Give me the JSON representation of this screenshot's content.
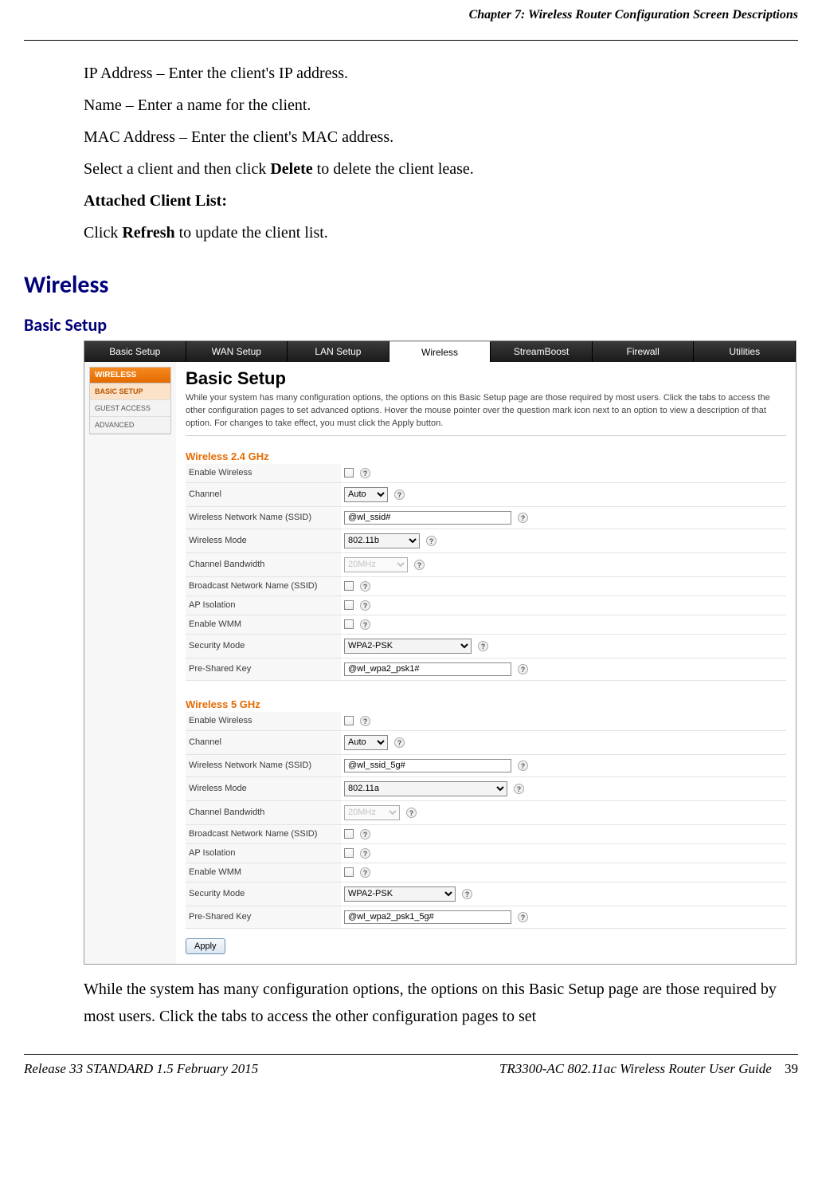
{
  "header": {
    "chapter": "Chapter 7: Wireless Router Configuration Screen Descriptions"
  },
  "intro": {
    "p1": "IP Address – Enter the client's IP address.",
    "p2": "Name – Enter a name for the client.",
    "p3": "MAC Address – Enter the client's MAC address.",
    "p4_pre": "Select a client and then click ",
    "p4_b": "Delete",
    "p4_post": " to delete the client lease.",
    "p5": "Attached Client List:",
    "p6_pre": "Click ",
    "p6_b": "Refresh",
    "p6_post": " to update the client list."
  },
  "h1": "Wireless",
  "h2": "Basic Setup",
  "router": {
    "tabs": [
      "Basic Setup",
      "WAN Setup",
      "LAN Setup",
      "Wireless",
      "StreamBoost",
      "Firewall",
      "Utilities"
    ],
    "sidebar": {
      "head": "WIRELESS",
      "items": [
        "BASIC SETUP",
        "GUEST ACCESS",
        "ADVANCED"
      ]
    },
    "title": "Basic Setup",
    "desc": "While your system has many configuration options, the options on this Basic Setup page are those required by most users. Click the tabs to access the other configuration pages to set advanced options. Hover the mouse pointer over the question mark icon next to an option to view a description of that option. For changes to take effect, you must click the Apply button.",
    "g24": {
      "title": "Wireless 2.4 GHz",
      "rows": {
        "enable": "Enable Wireless",
        "channel_lbl": "Channel",
        "channel_val": "Auto",
        "ssid_lbl": "Wireless Network Name (SSID)",
        "ssid_val": "@wl_ssid#",
        "mode_lbl": "Wireless Mode",
        "mode_val": "802.11b",
        "bw_lbl": "Channel Bandwidth",
        "bw_val": "20MHz",
        "broadcast": "Broadcast Network Name (SSID)",
        "ap": "AP Isolation",
        "wmm": "Enable WMM",
        "sec_lbl": "Security Mode",
        "sec_val": "WPA2-PSK",
        "psk_lbl": "Pre-Shared Key",
        "psk_val": "@wl_wpa2_psk1#"
      }
    },
    "g5": {
      "title": "Wireless 5 GHz",
      "rows": {
        "enable": "Enable Wireless",
        "channel_lbl": "Channel",
        "channel_val": "Auto",
        "ssid_lbl": "Wireless Network Name (SSID)",
        "ssid_val": "@wl_ssid_5g#",
        "mode_lbl": "Wireless Mode",
        "mode_val": "802.11a",
        "bw_lbl": "Channel Bandwidth",
        "bw_val": "20MHz",
        "broadcast": "Broadcast Network Name (SSID)",
        "ap": "AP Isolation",
        "wmm": "Enable WMM",
        "sec_lbl": "Security Mode",
        "sec_val": "WPA2-PSK",
        "psk_lbl": "Pre-Shared Key",
        "psk_val": "@wl_wpa2_psk1_5g#"
      }
    },
    "apply": "Apply"
  },
  "outro": "While the system has many configuration options, the options on this Basic Setup page are those required by most users.  Click the tabs to access the other configuration pages to set",
  "footer": {
    "left": "Release 33 STANDARD 1.5    February 2015",
    "right_title": "TR3300-AC 802.11ac Wireless Router User Guide",
    "page": "39"
  }
}
